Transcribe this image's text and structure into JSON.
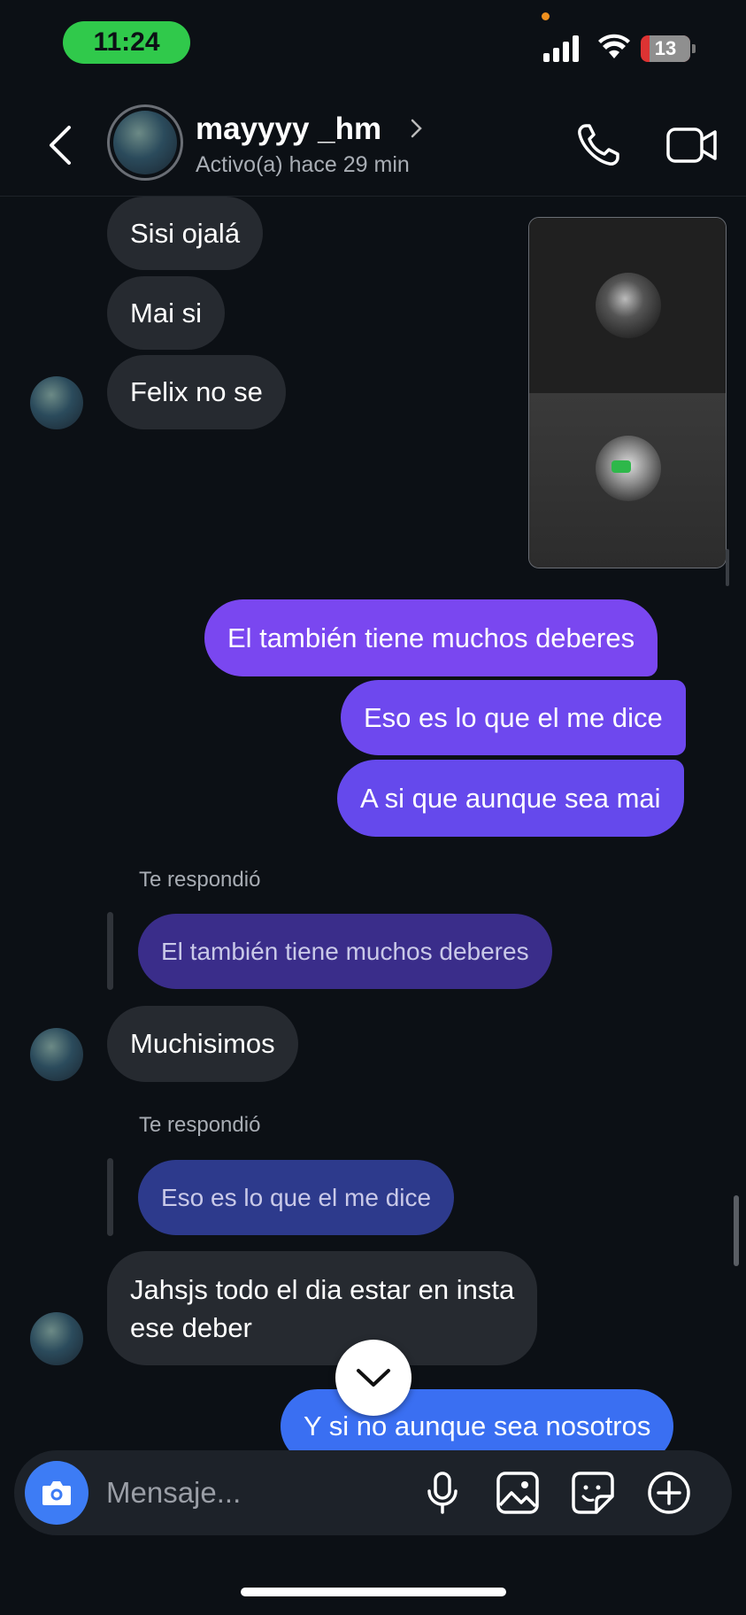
{
  "status_bar": {
    "time": "11:24",
    "battery": "13"
  },
  "header": {
    "username": "mayyyy _hm",
    "active_status": "Activo(a) hace 29 min"
  },
  "messages": {
    "m1": "Sisi ojalá",
    "m2": "Mai si",
    "m3": "Felix no se",
    "s1": "El también tiene muchos deberes",
    "s2": "Eso es lo que el me dice",
    "s3": "A si que aunque sea mai",
    "reply1_label": "Te respondió",
    "reply1_quote": "El también tiene muchos deberes",
    "m4": "Muchisimos",
    "reply2_label": "Te respondió",
    "reply2_quote": "Eso es lo que el me dice",
    "m5_line1": "Jahsjs todo el dia estar en insta",
    "m5_line2": "ese deber",
    "s4": "Y si no aunque sea nosotros"
  },
  "composer": {
    "placeholder": "Mensaje..."
  },
  "icons": {
    "back": "chevron-left-icon",
    "call": "phone-icon",
    "video": "video-camera-icon",
    "camera": "camera-icon",
    "mic": "microphone-icon",
    "gallery": "image-icon",
    "sticker": "sticker-icon",
    "add": "plus-circle-icon",
    "scroll_down": "chevron-down-icon"
  },
  "colors": {
    "background": "#0c1015",
    "received_bubble": "#262a30",
    "sent_purple": "#7a47f0",
    "sent_blue": "#3a6ff2",
    "camera_button": "#3d7cf5",
    "time_pill": "#30c94b"
  }
}
